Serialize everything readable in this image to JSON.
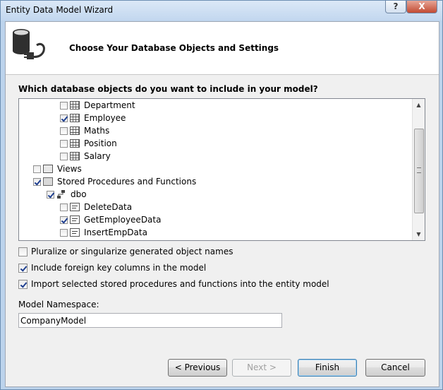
{
  "window": {
    "title": "Entity Data Model Wizard",
    "help_glyph": "?",
    "close_glyph": "X"
  },
  "header": {
    "title": "Choose Your Database Objects and Settings",
    "icon": "database-plug-icon"
  },
  "question": "Which database objects do you want to include in your model?",
  "tree": {
    "items": [
      {
        "label": "Department",
        "checked": false,
        "icon": "table-icon"
      },
      {
        "label": "Employee",
        "checked": true,
        "icon": "table-icon"
      },
      {
        "label": "Maths",
        "checked": false,
        "icon": "table-icon"
      },
      {
        "label": "Position",
        "checked": false,
        "icon": "table-icon"
      },
      {
        "label": "Salary",
        "checked": false,
        "icon": "table-icon"
      },
      {
        "label": "Views",
        "checked": false,
        "icon": "views-icon"
      },
      {
        "label": "Stored Procedures and Functions",
        "checked": true,
        "icon": "procedures-icon"
      },
      {
        "label": "dbo",
        "checked": true,
        "icon": "schema-icon"
      },
      {
        "label": "DeleteData",
        "checked": false,
        "icon": "stored-procedure-icon"
      },
      {
        "label": "GetEmployeeData",
        "checked": true,
        "icon": "stored-procedure-icon"
      },
      {
        "label": "InsertEmpData",
        "checked": false,
        "icon": "stored-procedure-icon"
      }
    ]
  },
  "options": {
    "pluralize": {
      "label": "Pluralize or singularize generated object names",
      "checked": false
    },
    "foreign_keys": {
      "label": "Include foreign key columns in the model",
      "checked": true
    },
    "import_procs": {
      "label": "Import selected stored procedures and functions into the entity model",
      "checked": true
    }
  },
  "namespace": {
    "label": "Model Namespace:",
    "value": "CompanyModel"
  },
  "buttons": {
    "previous": "< Previous",
    "next": "Next >",
    "finish": "Finish",
    "cancel": "Cancel"
  }
}
